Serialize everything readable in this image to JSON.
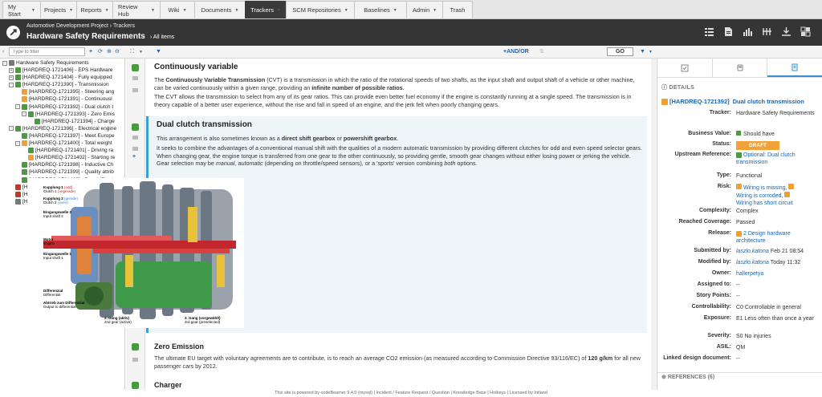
{
  "nav": {
    "tabs": [
      {
        "label": "My Start",
        "caret": true
      },
      {
        "label": "Projects",
        "caret": true
      },
      {
        "label": "Reports",
        "caret": true
      },
      {
        "label": "Review Hub",
        "caret": true
      },
      {
        "label": "Wiki",
        "caret": true
      },
      {
        "label": "Documents",
        "caret": true
      },
      {
        "label": "Trackers",
        "caret": true,
        "active": true
      },
      {
        "label": "SCM Repositories",
        "caret": true
      },
      {
        "label": "Baselines",
        "caret": true
      },
      {
        "label": "Admin",
        "caret": true
      },
      {
        "label": "Trash",
        "caret": false
      }
    ]
  },
  "header": {
    "breadcrumb": "Automotive Development Project › Trackers",
    "title": "Hardware Safety Requirements",
    "view": "› All items"
  },
  "toolbar": {
    "filter_placeholder": "Type to filter",
    "andor": "+AND/OR",
    "go": "GO"
  },
  "tree": {
    "root": "Hardware Safety Requirements",
    "items": [
      {
        "text": "[HARDREQ-1721406] - EPS Hardware",
        "c": "g",
        "d": 1,
        "t": "+"
      },
      {
        "text": "[HARDREQ-1721404] - Fully equipped",
        "c": "g",
        "d": 1,
        "t": "+"
      },
      {
        "text": "[HARDREQ-1721390] - Transmission",
        "c": "g",
        "d": 1,
        "t": "-"
      },
      {
        "text": "[HARDREQ-1721395] - Steering ang",
        "c": "o",
        "d": 2,
        "t": ""
      },
      {
        "text": "[HARDREQ-1721391] - Continuousl",
        "c": "o",
        "d": 2,
        "t": ""
      },
      {
        "text": "[HARDREQ-1721392] - Dual clutch t",
        "c": "g",
        "d": 2,
        "t": "-"
      },
      {
        "text": "[HARDREQ-1721393] - Zero Emis",
        "c": "g",
        "d": 3,
        "t": "-"
      },
      {
        "text": "[HARDREQ-1721394] - Charge",
        "c": "g",
        "d": 4,
        "t": ""
      },
      {
        "text": "[HARDREQ-1721396] - Electrical engine",
        "c": "g",
        "d": 1,
        "t": "-"
      },
      {
        "text": "[HARDREQ-1721397] - Meet Europe",
        "c": "g",
        "d": 2,
        "t": ""
      },
      {
        "text": "[HARDREQ-1721400] - Total weight",
        "c": "o",
        "d": 2,
        "t": "-"
      },
      {
        "text": "[HARDREQ-1721401] - Driving ra",
        "c": "g",
        "d": 3,
        "t": ""
      },
      {
        "text": "[HARDREQ-1721402] - Starting re",
        "c": "o",
        "d": 3,
        "t": ""
      },
      {
        "text": "[HARDREQ-1721398] - Inductive Ch",
        "c": "g",
        "d": 2,
        "t": ""
      },
      {
        "text": "[HARDREQ-1721399] - Quality attrib",
        "c": "g",
        "d": 2,
        "t": ""
      },
      {
        "text": "[HARDREQ-1721403] - Board ID - d",
        "c": "g",
        "d": 2,
        "t": ""
      },
      {
        "text": "[HARDREQ-1721415] - The LCD board",
        "c": "r",
        "d": 1,
        "t": ""
      },
      {
        "text": "[HARDREQ-1768212] - Navigation Inter",
        "c": "r",
        "d": 1,
        "t": ""
      },
      {
        "text": "[HARDREQ-1878927] - The gearbox m",
        "c": "gr",
        "d": 1,
        "t": ""
      }
    ]
  },
  "sections": {
    "s1": {
      "title": "Continuously variable",
      "p1a": "The ",
      "p1b": "Continuously Variable Transmission",
      "p1c": " (CVT) is a transmission in which the ratio of the rotational speeds of two shafts, as the input shaft and output shaft of a vehicle or other machine, can be varied continuously within a given range, providing an ",
      "p1d": "infinite number of possible ratios",
      "p1e": ".",
      "p2": "The CVT allows the transmission to select from any of its gear ratios. This can provide even better fuel economy if the engine is constantly running at a single speed. The transmission is in theory capable of a better user experience, without the rise and fall in speed of an engine, and the jerk felt when poorly changing gears."
    },
    "s2": {
      "title": "Dual clutch transmission",
      "p1a": "This arrangement is also sometimes known as a ",
      "p1b": "direct shift gearbox",
      "p1c": " or ",
      "p1d": "powershift gearbox",
      "p1e": ".",
      "p2a": "It seeks to combine the advantages of a conventional manual shift with the qualities of a modern automatic transmission by providing different clutches for odd and even speed selector gears. When changing gear, the engine torque is transferred from one gear to the other continuously, so providing gentle, smooth gear changes without either losing power or jerking the vehicle. Gear selection may be ",
      "p2b": "manual",
      "p2c": ", ",
      "p2d": "automatic",
      "p2e": " (depending on throttle/speed sensors), or a 'sports' version combining ",
      "p2f": "both",
      "p2g": " options."
    },
    "s3": {
      "title": "Zero Emission",
      "pa": "The ultimate EU target with voluntary agreements are to contribute, is to reach an average CO2 emission (as measured according to Commission Directive 93/116/EC) of ",
      "pb": "120  g/km",
      "pc": " for all new passenger cars by 2012."
    },
    "s4": {
      "title": "Charger"
    }
  },
  "figure": {
    "l1a": "Kupplung 1",
    "l1b": "(odd)",
    "l1c": "Clutch 1",
    "l1d": "(ungerade)",
    "l2a": "Kupplung 2",
    "l2b": "(gerade)",
    "l2c": "Clutch 2",
    "l2d": "(even)",
    "l3a": "Eingangswelle 2",
    "l3b": "Input shaft 2",
    "l4a": "Motor",
    "l4b": "Engine",
    "l5a": "Eingangswelle 1",
    "l5b": "Input shaft 1",
    "l6a": "Differenzial",
    "l6b": "Differential",
    "l7a": "Abtrieb zum Differenzial",
    "l7b": "Output to differential",
    "l8a": "2. Gang (aktiv)",
    "l8b": "2nd gear (active)",
    "l9a": "3. Gang (vorgewählt)",
    "l9b": "3rd gear (preselected)"
  },
  "details": {
    "heading": "DETAILS",
    "item_id": "[HARDREQ-1721392]",
    "item_title": "Dual clutch transmission",
    "fields": [
      {
        "label": "Tracker:",
        "value": "Hardware Safety Requirements"
      },
      {
        "label": "Business Value:",
        "value": "Should have"
      },
      {
        "label": "Status:",
        "value": "DRAFT"
      },
      {
        "label": "Upstream Reference:",
        "value": "Optional: Dual clutch transmission"
      },
      {
        "label": "Type:",
        "value": "Functional"
      },
      {
        "label": "Risk:",
        "r1": "Wiring is missing",
        "r2": "Wiring is corroded",
        "r3": "Wiring has short circuit"
      },
      {
        "label": "Complexity:",
        "value": "Complex"
      },
      {
        "label": "Reached Coverage:",
        "value": "Passed"
      },
      {
        "label": "Release:",
        "value": "2 Design hardware architecture"
      },
      {
        "label": "Submitted by:",
        "user": "laszlo.katona",
        "date": "Feb 21 08:54"
      },
      {
        "label": "Modified by:",
        "user": "laszlo.katona",
        "date": "Today 11:32"
      },
      {
        "label": "Owner:",
        "value": "hallerpetya"
      },
      {
        "label": "Assigned to:",
        "value": "--"
      },
      {
        "label": "Story Points:",
        "value": "--"
      },
      {
        "label": "Controllability:",
        "value": "C0 Controllable in general"
      },
      {
        "label": "Exposure:",
        "value": "E1 Less often than once a year"
      },
      {
        "label": "Severity:",
        "value": "S0 No injuries"
      },
      {
        "label": "ASIL:",
        "value": "QM"
      },
      {
        "label": "Linked design document:",
        "value": "--"
      }
    ],
    "references": "REFERENCES (6)"
  },
  "footer": "This site is powered by codeBeamer 9.4.0 (mysql) | Incident / Feature Request / Question | Knowledge Base | Hotkeys | Licensed by Intland",
  "colors": {
    "accent": "#1a66b3",
    "header": "#353535",
    "status": "#f3a23a",
    "green": "#4a9a3f",
    "orange": "#f0a030",
    "red": "#c0392b"
  }
}
